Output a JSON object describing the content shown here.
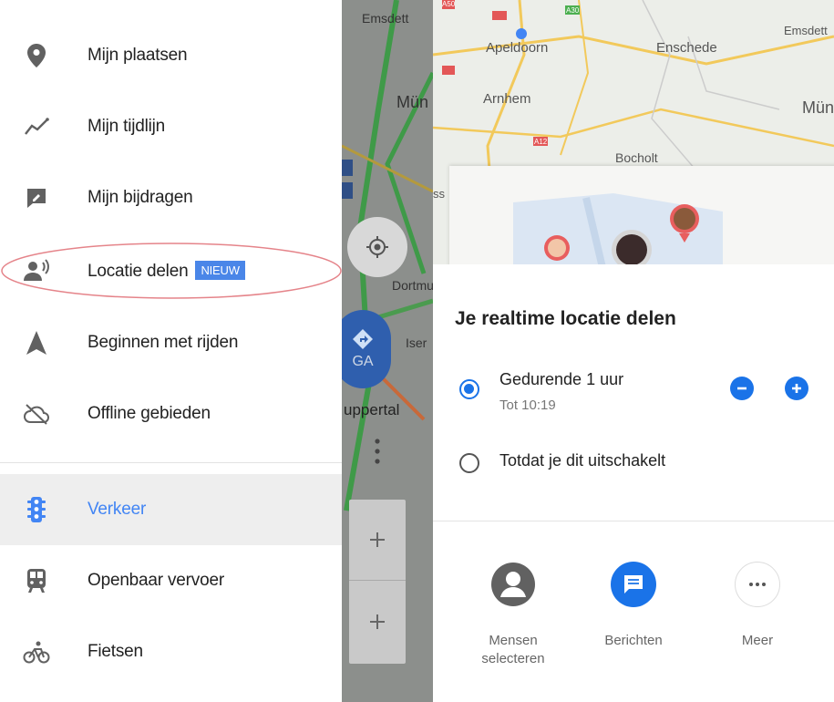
{
  "drawer": {
    "items": [
      {
        "label": "Mijn plaatsen"
      },
      {
        "label": "Mijn tijdlijn"
      },
      {
        "label": "Mijn bijdragen"
      },
      {
        "label": "Locatie delen",
        "badge": "NIEUW"
      },
      {
        "label": "Beginnen met rijden"
      },
      {
        "label": "Offline gebieden"
      },
      {
        "label": "Verkeer"
      },
      {
        "label": "Openbaar vervoer"
      },
      {
        "label": "Fietsen"
      }
    ]
  },
  "map_strip": {
    "labels": [
      "Emsdett",
      "Mün",
      "Dortmund",
      "Iser",
      "uppertal"
    ],
    "navigate_button": "GA"
  },
  "share_map": {
    "labels": [
      "Apeldoorn",
      "Enschede",
      "Emsdett",
      "Arnhem",
      "Mün",
      "Bocholt",
      "ss"
    ],
    "road_shields": [
      "A50",
      "A30",
      "A12"
    ]
  },
  "share": {
    "title": "Je realtime locatie delen",
    "option1": {
      "label": "Gedurende 1 uur",
      "sub": "Tot 10:19"
    },
    "option2": {
      "label": "Totdat je dit uitschakelt"
    },
    "actions": [
      {
        "label": "Mensen selecteren"
      },
      {
        "label": "Berichten"
      },
      {
        "label": "Meer"
      }
    ]
  },
  "colors": {
    "accent": "#1a73e8",
    "highlight_oval": "#e5848a",
    "traffic_active": "#4285f4"
  }
}
